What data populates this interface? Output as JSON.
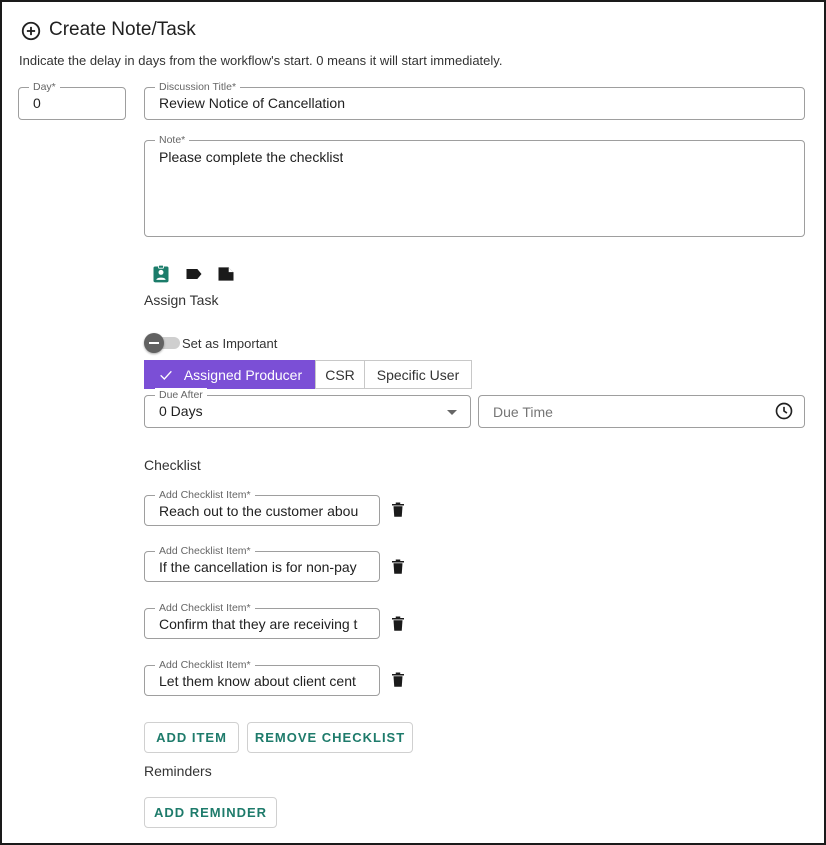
{
  "header": {
    "icon": "add-circle-icon",
    "title": "Create Note/Task",
    "subtext": "Indicate the delay in days from the workflow's start. 0 means it will start immediately."
  },
  "day": {
    "label": "Day*",
    "value": "0"
  },
  "discussion_title": {
    "label": "Discussion Title*",
    "value": "Review Notice of Cancellation"
  },
  "note": {
    "label": "Note*",
    "value": "Please complete the checklist"
  },
  "icons": {
    "assign_task": "assignment-ind-icon",
    "tag": "label-icon",
    "note": "sticky-note-icon"
  },
  "assign_task_label": "Assign Task",
  "important_toggle": {
    "label": "Set as Important",
    "on": false
  },
  "assignee": {
    "options": [
      "Assigned Producer",
      "CSR",
      "Specific User"
    ],
    "selected": "Assigned Producer"
  },
  "due_after": {
    "label": "Due After",
    "value": "0 Days"
  },
  "due_time": {
    "placeholder": "Due Time"
  },
  "checklist": {
    "title": "Checklist",
    "item_label": "Add Checklist Item*",
    "items": [
      {
        "label": "Add Checklist Item*",
        "value": "Reach out to the customer abou"
      },
      {
        "label": "Add Checklist Item*",
        "value": "If the cancellation is for non-pay"
      },
      {
        "label": "Add Checklist Item*",
        "value": "Confirm that they are receiving t"
      },
      {
        "label": "Add Checklist Item*",
        "value": "Let them know about client cent"
      }
    ]
  },
  "buttons": {
    "add_item": "ADD ITEM",
    "remove_checklist": "REMOVE CHECKLIST",
    "add_reminder": "ADD REMINDER"
  },
  "reminders_label": "Reminders",
  "colors": {
    "accent_purple": "#7b4fd6",
    "teal": "#1e7b6b",
    "icon_green": "#1b7c6a"
  }
}
